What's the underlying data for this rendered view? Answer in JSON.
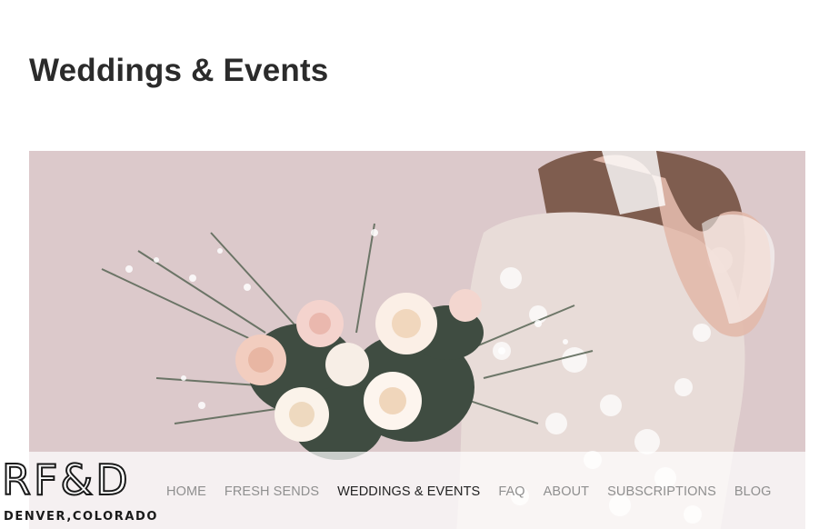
{
  "page": {
    "title": "Weddings & Events"
  },
  "hero": {
    "background_color": "#dcc9cb"
  },
  "brand": {
    "logo_mark": "RF&D",
    "logo_subtitle": "DENVER,COLORADO"
  },
  "nav": {
    "items": [
      {
        "label": "HOME",
        "active": false
      },
      {
        "label": "FRESH SENDS",
        "active": false
      },
      {
        "label": "WEDDINGS & EVENTS",
        "active": true
      },
      {
        "label": "FAQ",
        "active": false
      },
      {
        "label": "ABOUT",
        "active": false
      },
      {
        "label": "SUBSCRIPTIONS",
        "active": false
      },
      {
        "label": "BLOG",
        "active": false
      }
    ],
    "active_color": "#222222",
    "inactive_color": "#8f8f8f"
  }
}
